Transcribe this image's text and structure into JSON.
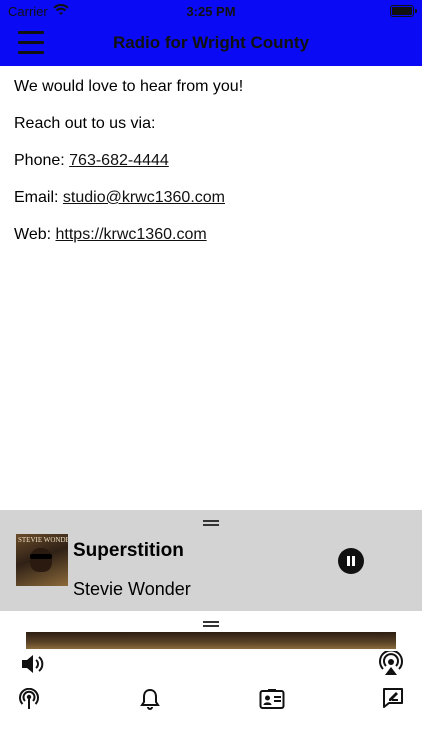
{
  "status_bar": {
    "carrier": "Carrier",
    "time": "3:25 PM"
  },
  "header": {
    "title": "Radio for Wright County"
  },
  "contact": {
    "intro": "We would love to hear from you!",
    "reach_out": "Reach out to us via:",
    "phone_label": "Phone: ",
    "phone_value": "763-682-4444",
    "email_label": "Email: ",
    "email_value": "studio@krwc1360.com",
    "web_label": "Web: ",
    "web_value": "https://krwc1360.com"
  },
  "now_playing": {
    "song": "Superstition",
    "artist": "Stevie Wonder",
    "album_art_text": "STEVIE WONDER"
  },
  "icons": {
    "menu": "hamburger-menu-icon",
    "volume": "speaker-volume-icon",
    "airplay": "airplay-audio-icon",
    "podcast": "podcast-broadcast-icon",
    "notifications": "bell-icon",
    "contact_card": "contact-card-icon",
    "message": "message-compose-icon"
  },
  "colors": {
    "header_bg": "#0a0af5",
    "now_playing_bg": "#d3d3d3"
  }
}
